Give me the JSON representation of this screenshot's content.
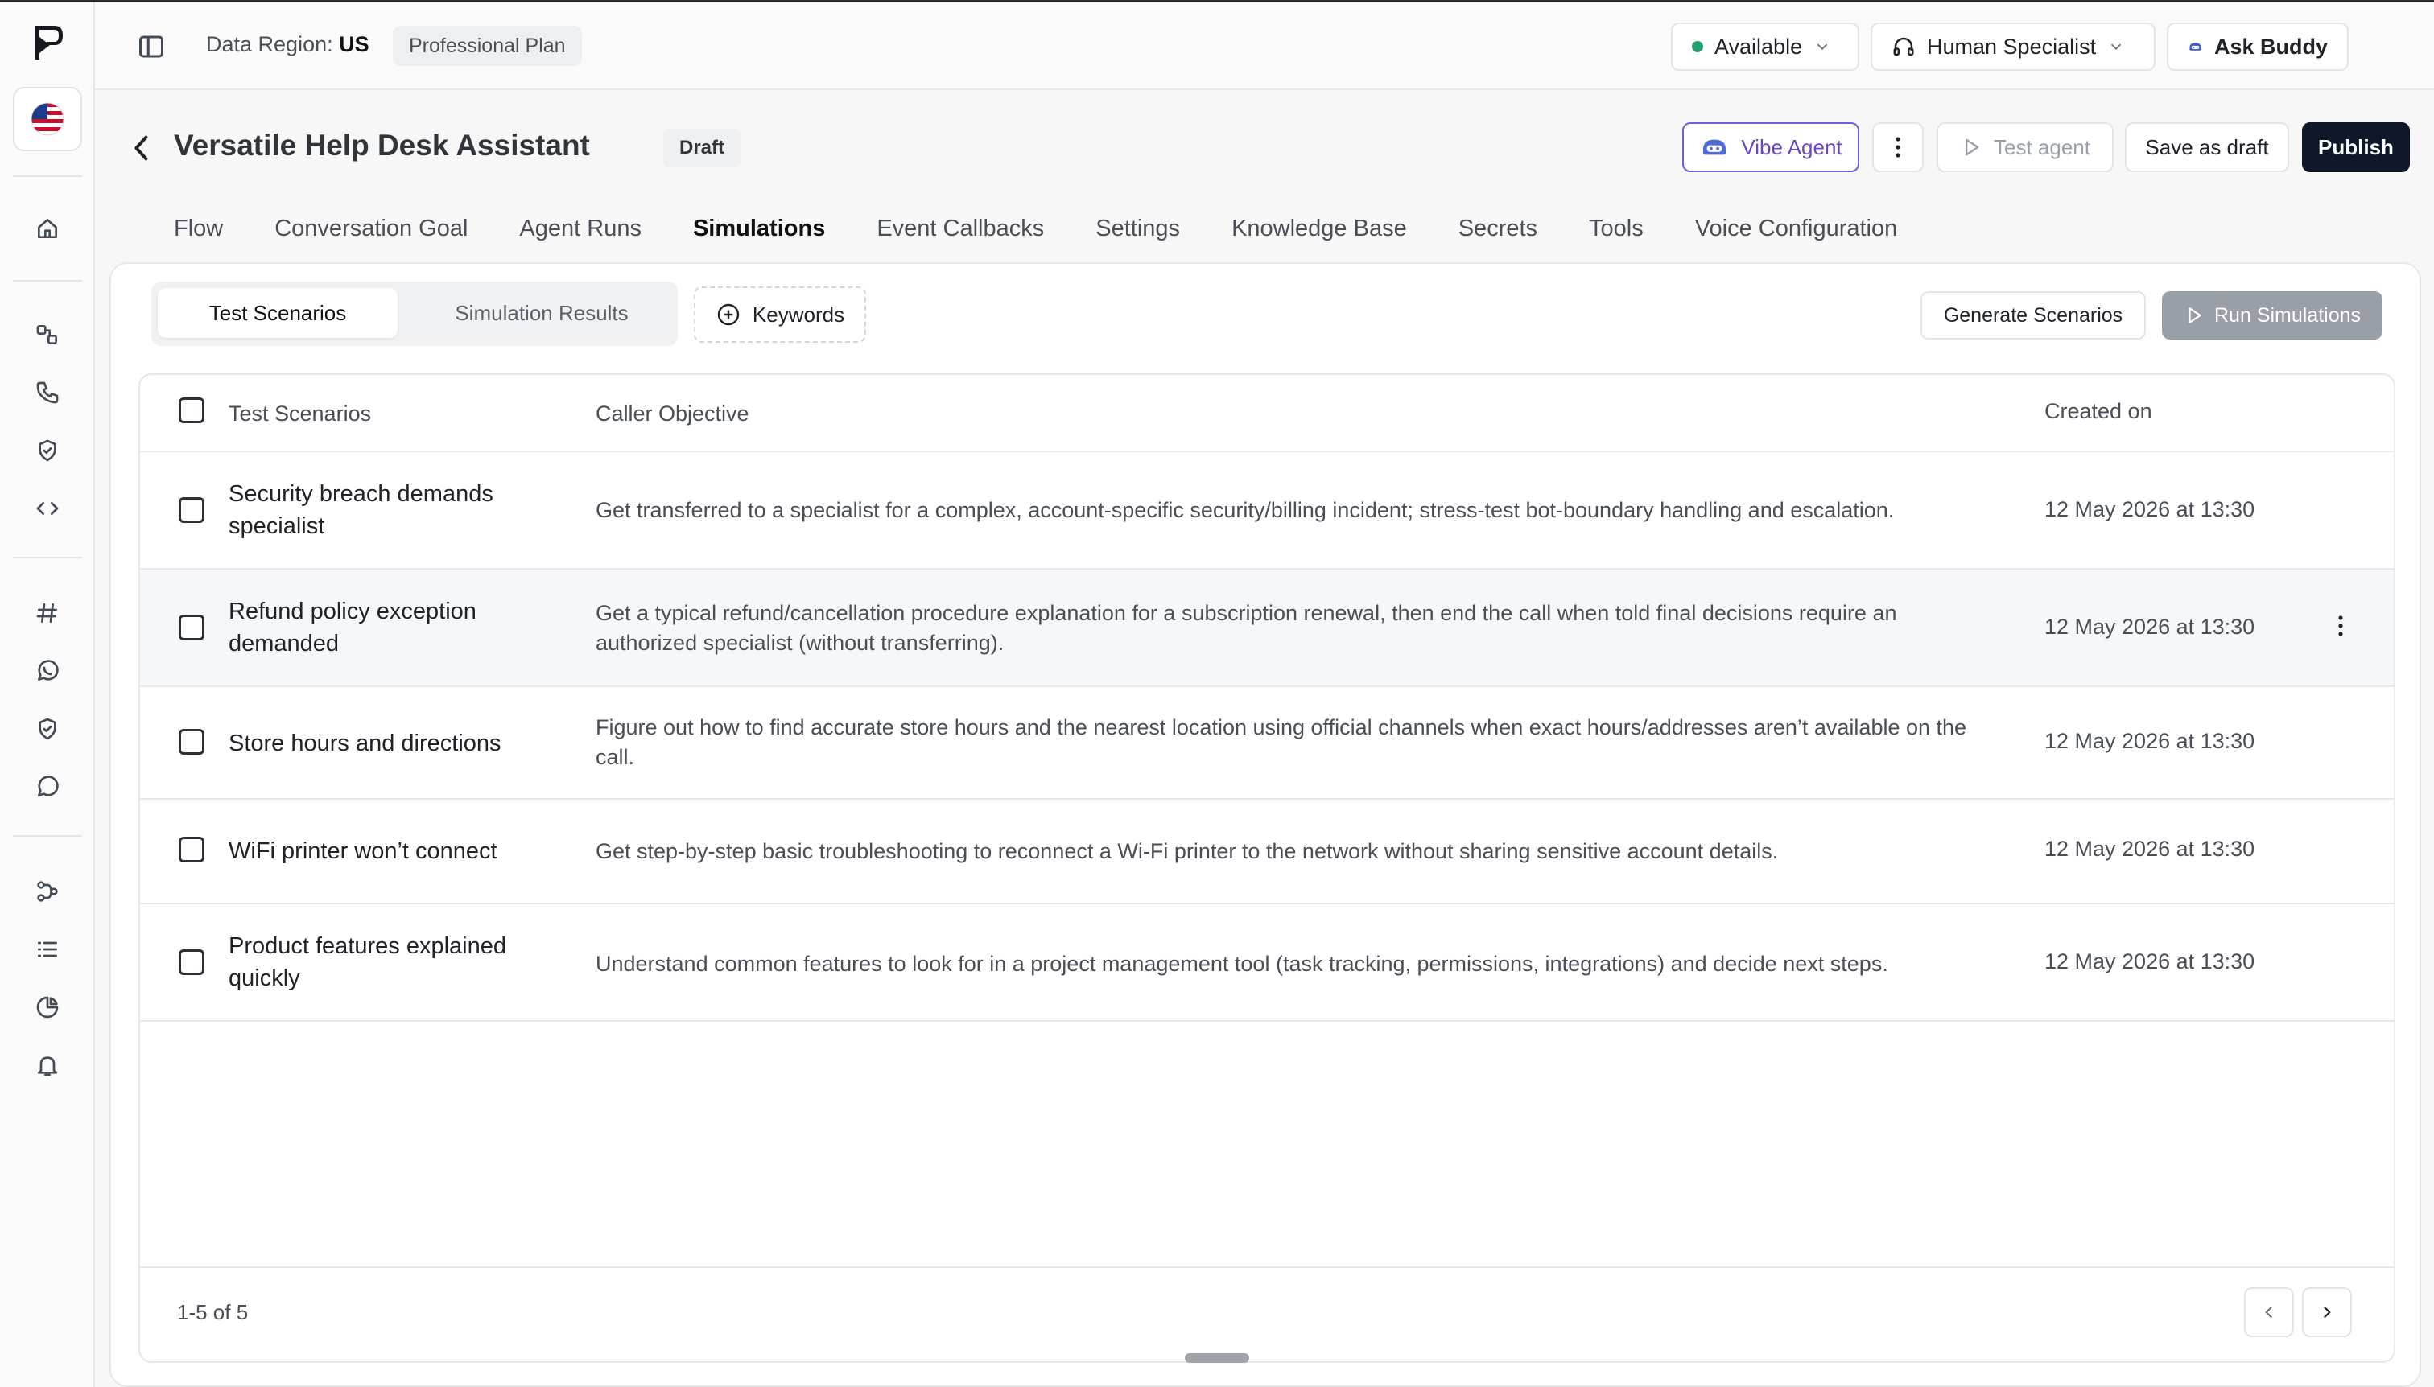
{
  "topbar": {
    "region_label": "Data Region:",
    "region_value": "US",
    "plan": "Professional Plan",
    "availability": "Available",
    "specialist": "Human Specialist",
    "ask_buddy": "Ask Buddy"
  },
  "header": {
    "title": "Versatile Help Desk Assistant",
    "status": "Draft",
    "vibe_agent": "Vibe Agent",
    "test_agent": "Test agent",
    "save_draft": "Save as draft",
    "publish": "Publish"
  },
  "tabs": [
    {
      "label": "Flow"
    },
    {
      "label": "Conversation Goal"
    },
    {
      "label": "Agent Runs"
    },
    {
      "label": "Simulations",
      "active": true
    },
    {
      "label": "Event Callbacks"
    },
    {
      "label": "Settings"
    },
    {
      "label": "Knowledge Base"
    },
    {
      "label": "Secrets"
    },
    {
      "label": "Tools"
    },
    {
      "label": "Voice Configuration"
    }
  ],
  "toolbar": {
    "seg_test": "Test Scenarios",
    "seg_results": "Simulation Results",
    "keywords": "Keywords",
    "generate": "Generate Scenarios",
    "run": "Run Simulations"
  },
  "table": {
    "columns": [
      "Test Scenarios",
      "Caller Objective",
      "Created on"
    ],
    "rows": [
      {
        "name": "Security breach demands specialist",
        "objective": "Get transferred to a specialist for a complex, account-specific security/billing incident; stress-test bot-boundary handling and escalation.",
        "created": "12 May 2026 at 13:30"
      },
      {
        "name": "Refund policy exception demanded",
        "objective": "Get a typical refund/cancellation procedure explanation for a subscription renewal, then end the call when told final decisions require an authorized specialist (without transferring).",
        "created": "12 May 2026 at 13:30"
      },
      {
        "name": "Store hours and directions",
        "objective": "Figure out how to find accurate store hours and the nearest location using official channels when exact hours/addresses aren’t available on the call.",
        "created": "12 May 2026 at 13:30"
      },
      {
        "name": "WiFi printer won’t connect",
        "objective": "Get step-by-step basic troubleshooting to reconnect a Wi-Fi printer to the network without sharing sensitive account details.",
        "created": "12 May 2026 at 13:30"
      },
      {
        "name": "Product features explained quickly",
        "objective": "Understand common features to look for in a project management tool (task tracking, permissions, integrations) and decide next steps.",
        "created": "12 May 2026 at 13:30"
      }
    ]
  },
  "pagination": {
    "range": "1-5 of 5"
  },
  "colors": {
    "accent_vibe": "#6b46c1",
    "publish_bg": "#0f172a",
    "available_dot": "#22a06b",
    "run_disabled": "#9a9ea6"
  },
  "icons": {
    "rail": [
      "logo-icon",
      "us-flag-icon",
      "home-icon",
      "flow-icon",
      "phone-icon",
      "shield-icon",
      "code-icon",
      "hash-icon",
      "whatsapp-icon",
      "shield-check-icon",
      "chat-icon",
      "workflow-icon",
      "list-icon",
      "pie-chart-icon",
      "bell-icon"
    ]
  }
}
